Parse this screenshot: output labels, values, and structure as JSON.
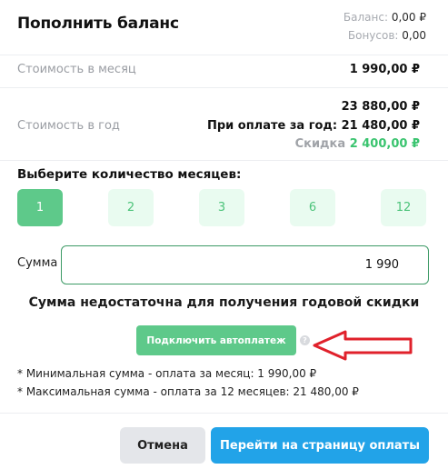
{
  "header": {
    "title": "Пополнить баланс",
    "balance_label": "Баланс:",
    "balance_value": "0,00 ₽",
    "bonus_label": "Бонусов:",
    "bonus_value": "0,00"
  },
  "pricing": {
    "monthly_label": "Стоимость в месяц",
    "monthly_value": "1 990,00 ₽",
    "yearly_label": "Стоимость в год",
    "yearly_value": "23 880,00 ₽",
    "yearly_prepay": "При оплате за год: 21 480,00 ₽",
    "discount_label": "Скидка",
    "discount_value": "2 400,00 ₽"
  },
  "months": {
    "title": "Выберите количество месяцев:",
    "options": [
      "1",
      "2",
      "3",
      "6",
      "12"
    ],
    "selected": "1"
  },
  "sum": {
    "label": "Сумма",
    "value": "1 990"
  },
  "notice": "Сумма недостаточна для получения годовой скидки",
  "autopay": {
    "button_label": "Подключить автоплатеж",
    "help": "?"
  },
  "notes": [
    "* Минимальная сумма - оплата за месяц: 1 990,00 ₽",
    "* Максимальная сумма - оплата за 12 месяцев: 21 480,00 ₽"
  ],
  "footer": {
    "cancel_label": "Отмена",
    "pay_label": "Перейти на страницу оплаты"
  },
  "colors": {
    "accent_green": "#5ec98a",
    "light_green": "#e9fbf0",
    "discount_green": "#3ac46f",
    "blue": "#22a3e8",
    "annotation_red": "#e0212b"
  }
}
